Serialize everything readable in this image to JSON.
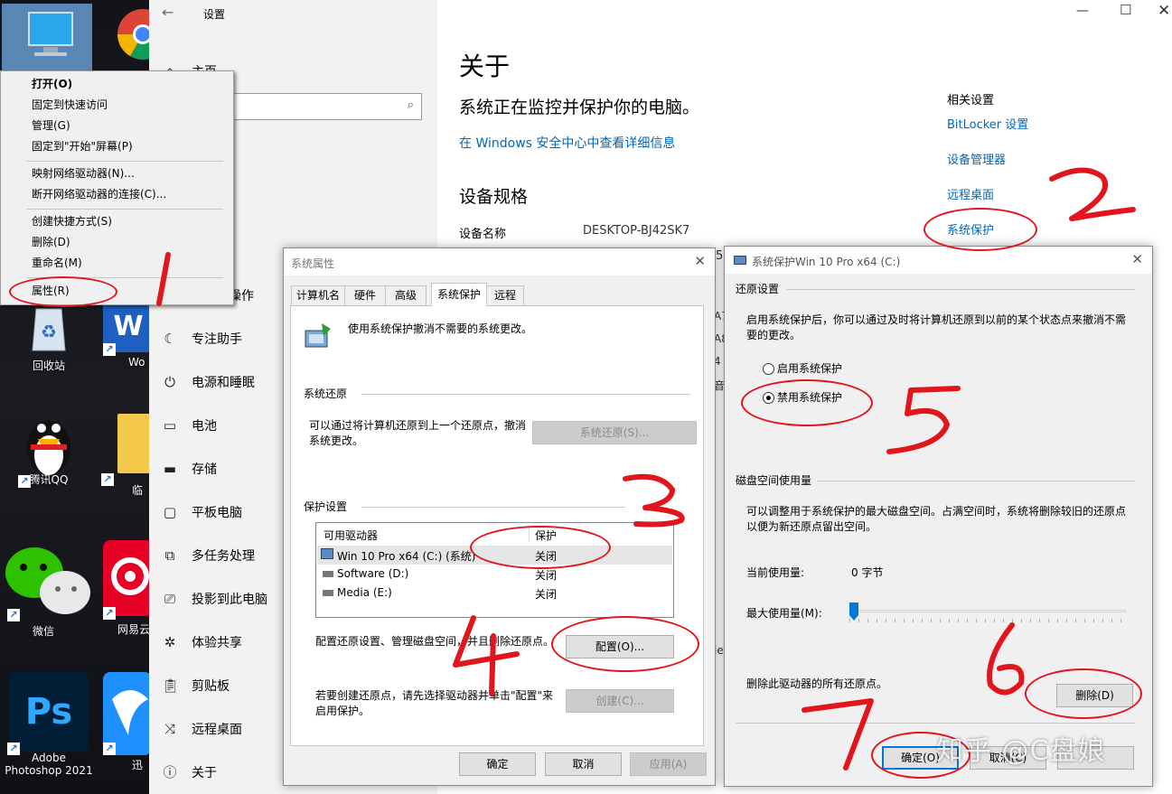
{
  "desktop": {
    "icons": [
      {
        "name": "this-pc",
        "label": ""
      },
      {
        "name": "chrome",
        "label": ""
      },
      {
        "name": "recycle-bin",
        "label": "回收站"
      },
      {
        "name": "word",
        "label": "Wo"
      },
      {
        "name": "qq",
        "label": "腾讯QQ"
      },
      {
        "name": "folder",
        "label": "临"
      },
      {
        "name": "wechat",
        "label": "微信"
      },
      {
        "name": "netease-music",
        "label": "网易云"
      },
      {
        "name": "photoshop",
        "label": "Adobe Photoshop 2021"
      },
      {
        "name": "xunlei",
        "label": "迅"
      }
    ],
    "word_glyph": "W",
    "ps_glyph": "Ps"
  },
  "context_menu": {
    "items": [
      "打开(O)",
      "固定到快速访问",
      "管理(G)",
      "固定到\"开始\"屏幕(P)",
      "映射网络驱动器(N)...",
      "断开网络驱动器的连接(C)...",
      "创建快捷方式(S)",
      "删除(D)",
      "重命名(M)",
      "属性(R)"
    ]
  },
  "settings": {
    "title": "设置",
    "home": "主页",
    "nav": [
      "操作",
      "专注助手",
      "电源和睡眠",
      "电池",
      "存储",
      "平板电脑",
      "多任务处理",
      "投影到此电脑",
      "体验共享",
      "剪贴板",
      "远程桌面",
      "关于"
    ],
    "page_title": "关于",
    "protect_msg": "系统正在监控并保护你的电脑。",
    "security_link": "在 Windows 安全中心中查看详细信息",
    "specs_heading": "设备规格",
    "device_name_label": "设备名称",
    "device_name_value": "DESKTOP-BJ42SK7",
    "related_heading": "相关设置",
    "related_links": [
      "BitLocker 设置",
      "设备管理器",
      "远程桌面",
      "系统保护"
    ],
    "partial_text": [
      "5",
      "A7",
      "A8",
      "4",
      "音",
      "ie"
    ]
  },
  "sysprops": {
    "title": "系统属性",
    "tabs": [
      "计算机名",
      "硬件",
      "高级",
      "系统保护",
      "远程"
    ],
    "intro": "使用系统保护撤消不需要的系统更改。",
    "restore_heading": "系统还原",
    "restore_text": "可以通过将计算机还原到上一个还原点，撤消系统更改。",
    "restore_button": "系统还原(S)...",
    "protection_heading": "保护设置",
    "col_drive": "可用驱动器",
    "col_protect": "保护",
    "drives": [
      {
        "name": "Win 10 Pro x64 (C:) (系统)",
        "status": "关闭"
      },
      {
        "name": "Software (D:)",
        "status": "关闭"
      },
      {
        "name": "Media (E:)",
        "status": "关闭"
      }
    ],
    "config_text": "配置还原设置、管理磁盘空间，并且删除还原点。",
    "config_button": "配置(O)...",
    "create_text": "若要创建还原点，请先选择驱动器并单击\"配置\"来启用保护。",
    "create_button": "创建(C)...",
    "ok": "确定",
    "cancel": "取消",
    "apply": "应用(A)"
  },
  "sysprotect": {
    "title": "系统保护Win 10 Pro x64 (C:)",
    "restore_heading": "还原设置",
    "restore_desc": "启用系统保护后，你可以通过及时将计算机还原到以前的某个状态点来撤消不需要的更改。",
    "enable": "启用系统保护",
    "disable": "禁用系统保护",
    "disk_heading": "磁盘空间使用量",
    "disk_desc": "可以调整用于系统保护的最大磁盘空间。占满空间时，系统将删除较旧的还原点以便为新还原点留出空间。",
    "current_label": "当前使用量:",
    "current_value": "0 字节",
    "max_label": "最大使用量(M):",
    "max_level": 0.0,
    "delete_text": "删除此驱动器的所有还原点。",
    "delete_button": "删除(D)",
    "ok": "确定(O)",
    "cancel": "取消(C)"
  },
  "annotations": {
    "watermark": "知乎 @C盘娘"
  }
}
